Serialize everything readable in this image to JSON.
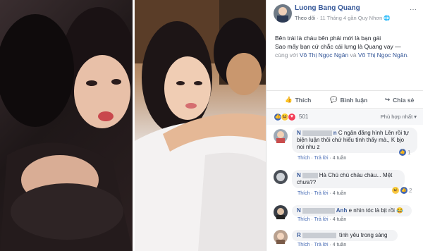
{
  "left_photo": {
    "alt": ""
  },
  "right_photo": {
    "alt": ""
  },
  "post": {
    "author": "Luong Bang Quang",
    "follow": "Theo dõi",
    "time": "11 Tháng 4 gần Quy Nhơn",
    "line1": "Bên trái là cháu bên phải mới là bạn gái",
    "line2": "Sao mấy bạn cứ chắc cái lưng là Quang vay —",
    "tag_prefix": "cùng với ",
    "tag1": "Võ Thị Ngọc Ngân",
    "tag_and": " và ",
    "tag2": "Võ Thị Ngọc Ngân",
    "tag_suffix": "."
  },
  "actions": {
    "like": "Thích",
    "comment": "Bình luận",
    "share": "Chia sẻ"
  },
  "reactions": {
    "count": "501",
    "sort": "Phù hợp nhất ▾"
  },
  "comments": [
    {
      "name_start": "N",
      "name_mid": "n",
      "text": " C ngân đăng hình Lên rồi tự biện luận thôi chứ hiểu tình thấy mà., K bjo noi nhu z",
      "like": "Thích",
      "reply": "Trả lời",
      "time": "4 tuần",
      "reaction_count": "1"
    },
    {
      "name_start": "N",
      "name_mid": "",
      "text": "Hà Chú chú cháu cháu... Mệt chưa??",
      "like": "Thích",
      "reply": "Trả lời",
      "time": "4 tuần",
      "reaction_count": "2"
    },
    {
      "name_start": "N",
      "name_mid": "Anh",
      "text": " e nhìn tóc là bịt rồi 😂",
      "like": "Thích",
      "reply": "Trả lời",
      "time": "4 tuần",
      "reaction_count": ""
    },
    {
      "name_start": "R",
      "name_mid": "",
      "text": " tình yêu trong sáng",
      "like": "Thích",
      "reply": "Trả lời",
      "time": "4 tuần",
      "reaction_count": ""
    }
  ],
  "colors": {
    "link": "#365899",
    "accent": "#4267b2",
    "muted": "#90949c"
  }
}
